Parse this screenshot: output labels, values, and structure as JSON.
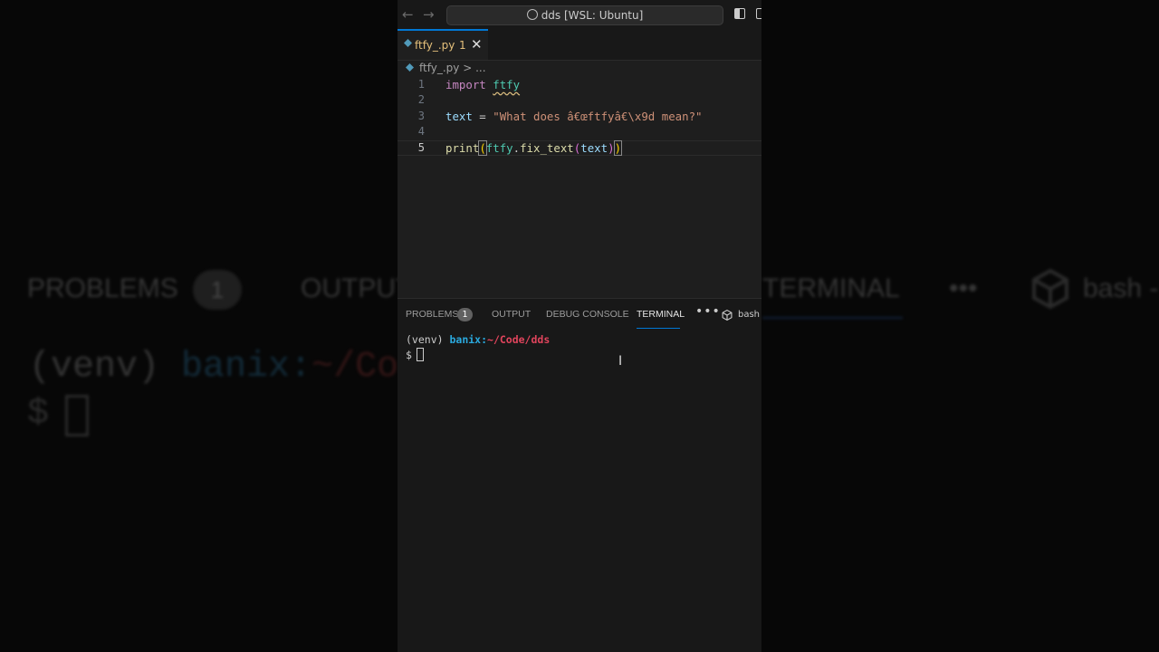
{
  "background": {
    "tabs": [
      "PROBLEMS",
      "OUTPUT",
      "TERMINAL",
      "•••",
      "bash -"
    ],
    "badge": "1",
    "prompt_env": "(venv) ",
    "prompt_user": "banix:",
    "prompt_path": "~/Code/dds",
    "prompt_dollar": "$"
  },
  "titlebar": {
    "command_center": "dds [WSL: Ubuntu]",
    "back_icon": "arrow-left-icon",
    "forward_icon": "arrow-right-icon"
  },
  "tab": {
    "label": "ftfy_.py",
    "problem_count": "1",
    "close": "✕"
  },
  "breadcrumb": {
    "file": "ftfy_.py",
    "separator": ">",
    "rest": "..."
  },
  "editor": {
    "lines": [
      {
        "num": "1",
        "text": "import ftfy"
      },
      {
        "num": "2",
        "text": ""
      },
      {
        "num": "3",
        "text": "text = \"What does â€œftfyâ€\\x9d mean?\""
      },
      {
        "num": "4",
        "text": ""
      },
      {
        "num": "5",
        "text": "print(ftfy.fix_text(text))"
      }
    ],
    "active_line": "5"
  },
  "panel": {
    "tabs": {
      "problems": "PROBLEMS",
      "problems_badge": "1",
      "output": "OUTPUT",
      "debug": "DEBUG CONSOLE",
      "terminal": "TERMINAL",
      "more": "•••",
      "bash": "bash -"
    },
    "terminal": {
      "env": "(venv) ",
      "user": "banix:",
      "path": "~/Code/dds",
      "dollar": "$"
    }
  },
  "colors": {
    "accent": "#0078d4",
    "keyword": "#c586c0",
    "module": "#4ec9b0",
    "string": "#ce9178",
    "function": "#dcdcaa",
    "user": "#2aa9de",
    "path": "#e0445c"
  }
}
